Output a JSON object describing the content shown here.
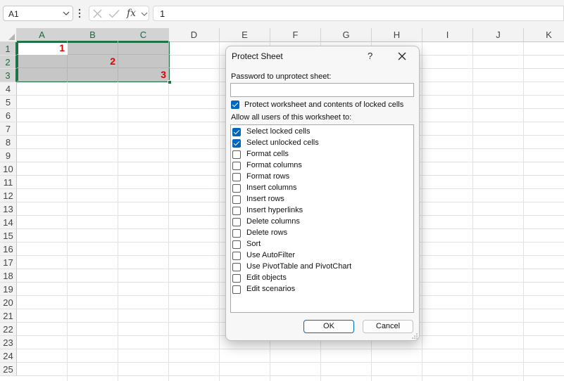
{
  "formula_bar": {
    "name_box": "A1",
    "fx_label": "fx",
    "formula_value": "1"
  },
  "grid": {
    "columns": [
      "A",
      "B",
      "C",
      "D",
      "E",
      "F",
      "G",
      "H",
      "I",
      "J",
      "K"
    ],
    "rows": [
      "1",
      "2",
      "3",
      "4",
      "5",
      "6",
      "7",
      "8",
      "9",
      "10",
      "11",
      "12",
      "13",
      "14",
      "15",
      "16",
      "17",
      "18",
      "19",
      "20",
      "21",
      "22",
      "23",
      "24",
      "25"
    ],
    "selected_columns": [
      "A",
      "B",
      "C"
    ],
    "selected_rows": [
      "1",
      "2",
      "3"
    ],
    "cells": {
      "A1": "1",
      "B2": "2",
      "C3": "3"
    },
    "value_color": "#e00000",
    "selection_color": "#217346"
  },
  "dialog": {
    "title": "Protect Sheet",
    "help": "?",
    "password_label": "Password to unprotect sheet:",
    "password_value": "",
    "protect_label": "Protect worksheet and contents of locked cells",
    "protect_checked": true,
    "allow_label": "Allow all users of this worksheet to:",
    "permissions": [
      {
        "label": "Select locked cells",
        "checked": true
      },
      {
        "label": "Select unlocked cells",
        "checked": true
      },
      {
        "label": "Format cells",
        "checked": false
      },
      {
        "label": "Format columns",
        "checked": false
      },
      {
        "label": "Format rows",
        "checked": false
      },
      {
        "label": "Insert columns",
        "checked": false
      },
      {
        "label": "Insert rows",
        "checked": false
      },
      {
        "label": "Insert hyperlinks",
        "checked": false
      },
      {
        "label": "Delete columns",
        "checked": false
      },
      {
        "label": "Delete rows",
        "checked": false
      },
      {
        "label": "Sort",
        "checked": false
      },
      {
        "label": "Use AutoFilter",
        "checked": false
      },
      {
        "label": "Use PivotTable and PivotChart",
        "checked": false
      },
      {
        "label": "Edit objects",
        "checked": false
      },
      {
        "label": "Edit scenarios",
        "checked": false
      }
    ],
    "ok_label": "OK",
    "cancel_label": "Cancel",
    "accent_color": "#0067c0"
  }
}
